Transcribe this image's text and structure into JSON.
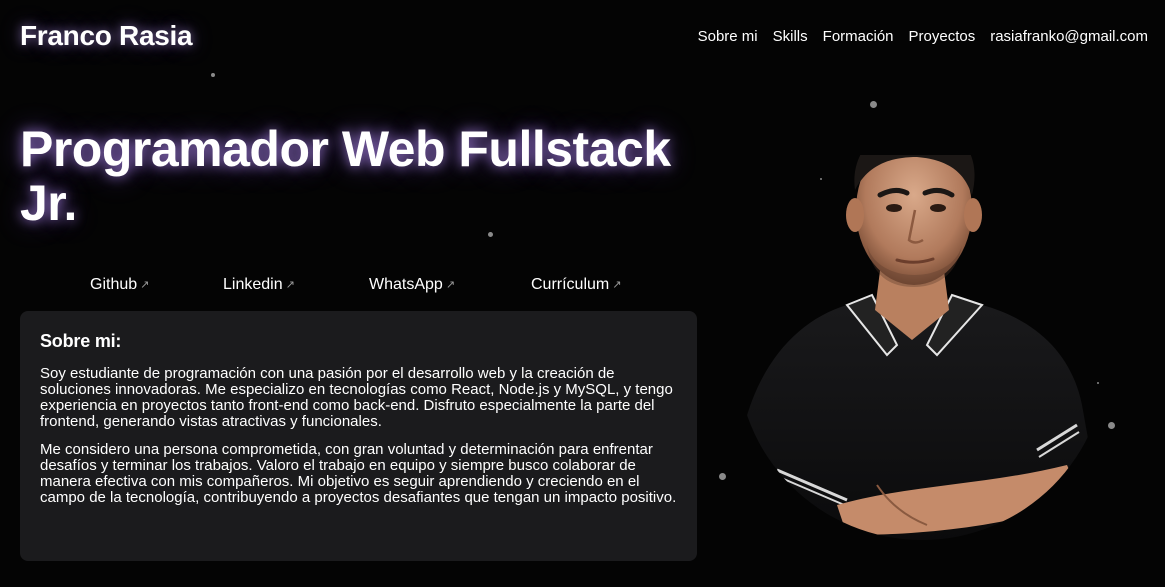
{
  "header": {
    "brand": "Franco Rasia",
    "nav": [
      "Sobre mi",
      "Skills",
      "Formación",
      "Proyectos",
      "rasiafranko@gmail.com"
    ]
  },
  "hero": {
    "title": "Programador Web Fullstack Jr."
  },
  "links": [
    {
      "label": "Github",
      "icon": "external-arrow-icon"
    },
    {
      "label": "Linkedin",
      "icon": "external-arrow-icon"
    },
    {
      "label": "WhatsApp",
      "icon": "external-arrow-icon"
    },
    {
      "label": "Currículum",
      "icon": "external-arrow-icon"
    }
  ],
  "about": {
    "heading": "Sobre mi:",
    "paragraphs": [
      "Soy estudiante de programación con una pasión por el desarrollo web y la creación de soluciones innovadoras. Me especializo en tecnologías como React, Node.js y MySQL, y tengo experiencia en proyectos tanto front-end como back-end. Disfruto especialmente la parte del frontend, generando vistas atractivas y funcionales.",
      "Me considero una persona comprometida, con gran voluntad y determinación para enfrentar desafíos y terminar los trabajos. Valoro el trabajo en equipo y siempre busco colaborar de manera efectiva con mis compañeros. Mi objetivo es seguir aprendiendo y creciendo en el campo de la tecnología, contribuyendo a proyectos desafiantes que tengan un impacto positivo."
    ]
  },
  "theme": {
    "background": "#040404",
    "card": "#1b1b1d",
    "glow": "#a07cff",
    "text": "#ffffff"
  }
}
